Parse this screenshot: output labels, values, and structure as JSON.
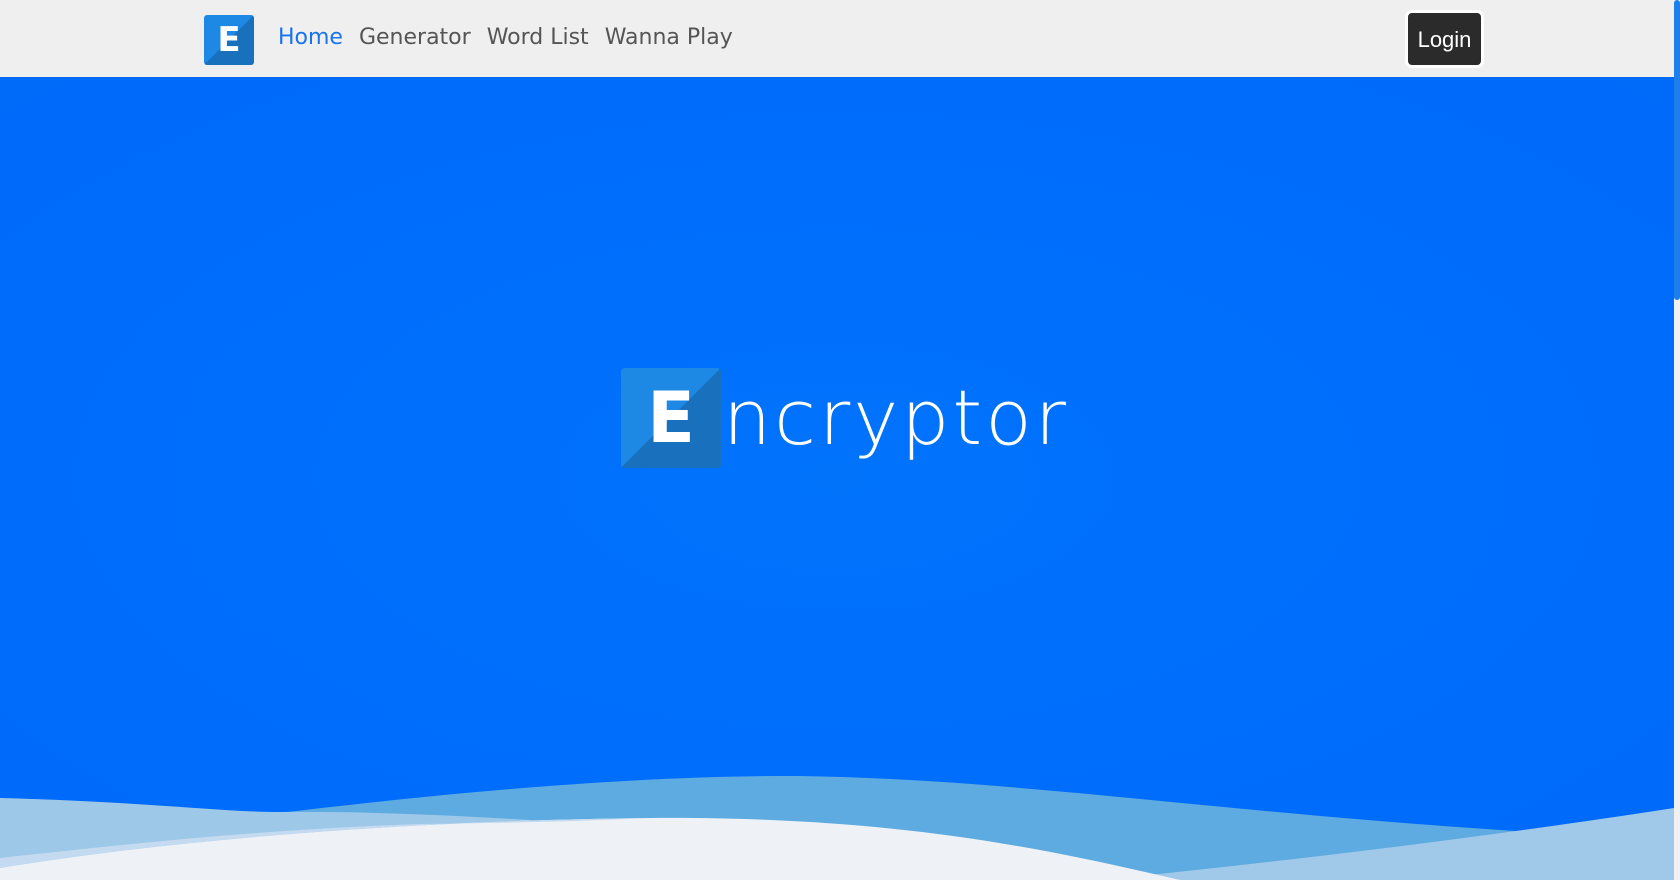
{
  "navbar": {
    "logo_letter": "E",
    "links": [
      {
        "label": "Home"
      },
      {
        "label": "Generator"
      },
      {
        "label": "Word List"
      },
      {
        "label": "Wanna Play"
      }
    ],
    "login_label": "Login"
  },
  "hero": {
    "logo_letter": "E",
    "title_rest": "ncryptor"
  },
  "colors": {
    "hero_bg": "#006dfd",
    "logo_bg": "#1e88e5",
    "nav_active": "#1a73e8",
    "navbar_bg": "#efefef",
    "login_bg": "#2b2b2b"
  }
}
